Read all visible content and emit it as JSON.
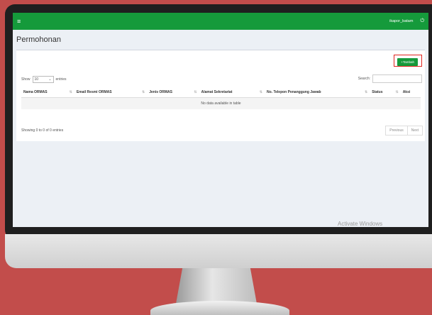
{
  "navbar": {
    "menu_icon": "≡",
    "username": "ikapor_batam",
    "power_icon": "⏻"
  },
  "page": {
    "title": "Permohonan"
  },
  "actions": {
    "add_label": "+Tambah"
  },
  "table_controls": {
    "show_label": "Show",
    "length_value": "10",
    "entries_label": "entries",
    "search_label": "Search:"
  },
  "table": {
    "columns": [
      "Nama ORMAS",
      "Email Resmi ORMAS",
      "Jenis ORMAS",
      "Alamat Sekretariat",
      "No. Telepon Penanggung Jawab",
      "Status",
      "Aksi"
    ],
    "empty_text": "No data available in table"
  },
  "footer": {
    "info": "Showing 0 to 0 of 0 entries",
    "previous_label": "Previous",
    "next_label": "Next"
  },
  "os": {
    "watermark": "Activate Windows"
  },
  "colors": {
    "accent": "#159a3b",
    "highlight": "#e0241f",
    "background": "#c24d4b"
  }
}
